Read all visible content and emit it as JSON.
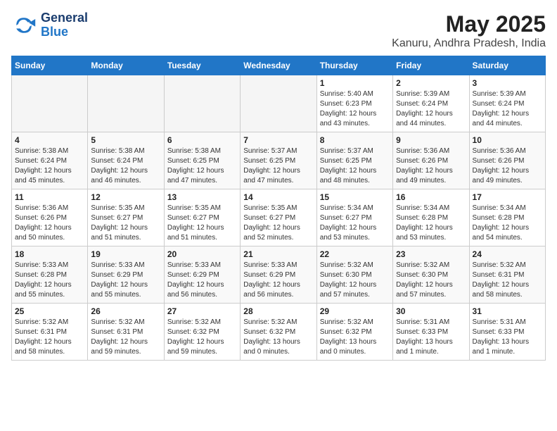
{
  "header": {
    "logo_line1": "General",
    "logo_line2": "Blue",
    "month": "May 2025",
    "location": "Kanuru, Andhra Pradesh, India"
  },
  "weekdays": [
    "Sunday",
    "Monday",
    "Tuesday",
    "Wednesday",
    "Thursday",
    "Friday",
    "Saturday"
  ],
  "weeks": [
    [
      {
        "day": "",
        "empty": true
      },
      {
        "day": "",
        "empty": true
      },
      {
        "day": "",
        "empty": true
      },
      {
        "day": "",
        "empty": true
      },
      {
        "day": "1",
        "sunrise": "Sunrise: 5:40 AM",
        "sunset": "Sunset: 6:23 PM",
        "daylight": "Daylight: 12 hours and 43 minutes."
      },
      {
        "day": "2",
        "sunrise": "Sunrise: 5:39 AM",
        "sunset": "Sunset: 6:24 PM",
        "daylight": "Daylight: 12 hours and 44 minutes."
      },
      {
        "day": "3",
        "sunrise": "Sunrise: 5:39 AM",
        "sunset": "Sunset: 6:24 PM",
        "daylight": "Daylight: 12 hours and 44 minutes."
      }
    ],
    [
      {
        "day": "4",
        "sunrise": "Sunrise: 5:38 AM",
        "sunset": "Sunset: 6:24 PM",
        "daylight": "Daylight: 12 hours and 45 minutes."
      },
      {
        "day": "5",
        "sunrise": "Sunrise: 5:38 AM",
        "sunset": "Sunset: 6:24 PM",
        "daylight": "Daylight: 12 hours and 46 minutes."
      },
      {
        "day": "6",
        "sunrise": "Sunrise: 5:38 AM",
        "sunset": "Sunset: 6:25 PM",
        "daylight": "Daylight: 12 hours and 47 minutes."
      },
      {
        "day": "7",
        "sunrise": "Sunrise: 5:37 AM",
        "sunset": "Sunset: 6:25 PM",
        "daylight": "Daylight: 12 hours and 47 minutes."
      },
      {
        "day": "8",
        "sunrise": "Sunrise: 5:37 AM",
        "sunset": "Sunset: 6:25 PM",
        "daylight": "Daylight: 12 hours and 48 minutes."
      },
      {
        "day": "9",
        "sunrise": "Sunrise: 5:36 AM",
        "sunset": "Sunset: 6:26 PM",
        "daylight": "Daylight: 12 hours and 49 minutes."
      },
      {
        "day": "10",
        "sunrise": "Sunrise: 5:36 AM",
        "sunset": "Sunset: 6:26 PM",
        "daylight": "Daylight: 12 hours and 49 minutes."
      }
    ],
    [
      {
        "day": "11",
        "sunrise": "Sunrise: 5:36 AM",
        "sunset": "Sunset: 6:26 PM",
        "daylight": "Daylight: 12 hours and 50 minutes."
      },
      {
        "day": "12",
        "sunrise": "Sunrise: 5:35 AM",
        "sunset": "Sunset: 6:27 PM",
        "daylight": "Daylight: 12 hours and 51 minutes."
      },
      {
        "day": "13",
        "sunrise": "Sunrise: 5:35 AM",
        "sunset": "Sunset: 6:27 PM",
        "daylight": "Daylight: 12 hours and 51 minutes."
      },
      {
        "day": "14",
        "sunrise": "Sunrise: 5:35 AM",
        "sunset": "Sunset: 6:27 PM",
        "daylight": "Daylight: 12 hours and 52 minutes."
      },
      {
        "day": "15",
        "sunrise": "Sunrise: 5:34 AM",
        "sunset": "Sunset: 6:27 PM",
        "daylight": "Daylight: 12 hours and 53 minutes."
      },
      {
        "day": "16",
        "sunrise": "Sunrise: 5:34 AM",
        "sunset": "Sunset: 6:28 PM",
        "daylight": "Daylight: 12 hours and 53 minutes."
      },
      {
        "day": "17",
        "sunrise": "Sunrise: 5:34 AM",
        "sunset": "Sunset: 6:28 PM",
        "daylight": "Daylight: 12 hours and 54 minutes."
      }
    ],
    [
      {
        "day": "18",
        "sunrise": "Sunrise: 5:33 AM",
        "sunset": "Sunset: 6:28 PM",
        "daylight": "Daylight: 12 hours and 55 minutes."
      },
      {
        "day": "19",
        "sunrise": "Sunrise: 5:33 AM",
        "sunset": "Sunset: 6:29 PM",
        "daylight": "Daylight: 12 hours and 55 minutes."
      },
      {
        "day": "20",
        "sunrise": "Sunrise: 5:33 AM",
        "sunset": "Sunset: 6:29 PM",
        "daylight": "Daylight: 12 hours and 56 minutes."
      },
      {
        "day": "21",
        "sunrise": "Sunrise: 5:33 AM",
        "sunset": "Sunset: 6:29 PM",
        "daylight": "Daylight: 12 hours and 56 minutes."
      },
      {
        "day": "22",
        "sunrise": "Sunrise: 5:32 AM",
        "sunset": "Sunset: 6:30 PM",
        "daylight": "Daylight: 12 hours and 57 minutes."
      },
      {
        "day": "23",
        "sunrise": "Sunrise: 5:32 AM",
        "sunset": "Sunset: 6:30 PM",
        "daylight": "Daylight: 12 hours and 57 minutes."
      },
      {
        "day": "24",
        "sunrise": "Sunrise: 5:32 AM",
        "sunset": "Sunset: 6:31 PM",
        "daylight": "Daylight: 12 hours and 58 minutes."
      }
    ],
    [
      {
        "day": "25",
        "sunrise": "Sunrise: 5:32 AM",
        "sunset": "Sunset: 6:31 PM",
        "daylight": "Daylight: 12 hours and 58 minutes."
      },
      {
        "day": "26",
        "sunrise": "Sunrise: 5:32 AM",
        "sunset": "Sunset: 6:31 PM",
        "daylight": "Daylight: 12 hours and 59 minutes."
      },
      {
        "day": "27",
        "sunrise": "Sunrise: 5:32 AM",
        "sunset": "Sunset: 6:32 PM",
        "daylight": "Daylight: 12 hours and 59 minutes."
      },
      {
        "day": "28",
        "sunrise": "Sunrise: 5:32 AM",
        "sunset": "Sunset: 6:32 PM",
        "daylight": "Daylight: 13 hours and 0 minutes."
      },
      {
        "day": "29",
        "sunrise": "Sunrise: 5:32 AM",
        "sunset": "Sunset: 6:32 PM",
        "daylight": "Daylight: 13 hours and 0 minutes."
      },
      {
        "day": "30",
        "sunrise": "Sunrise: 5:31 AM",
        "sunset": "Sunset: 6:33 PM",
        "daylight": "Daylight: 13 hours and 1 minute."
      },
      {
        "day": "31",
        "sunrise": "Sunrise: 5:31 AM",
        "sunset": "Sunset: 6:33 PM",
        "daylight": "Daylight: 13 hours and 1 minute."
      }
    ]
  ]
}
